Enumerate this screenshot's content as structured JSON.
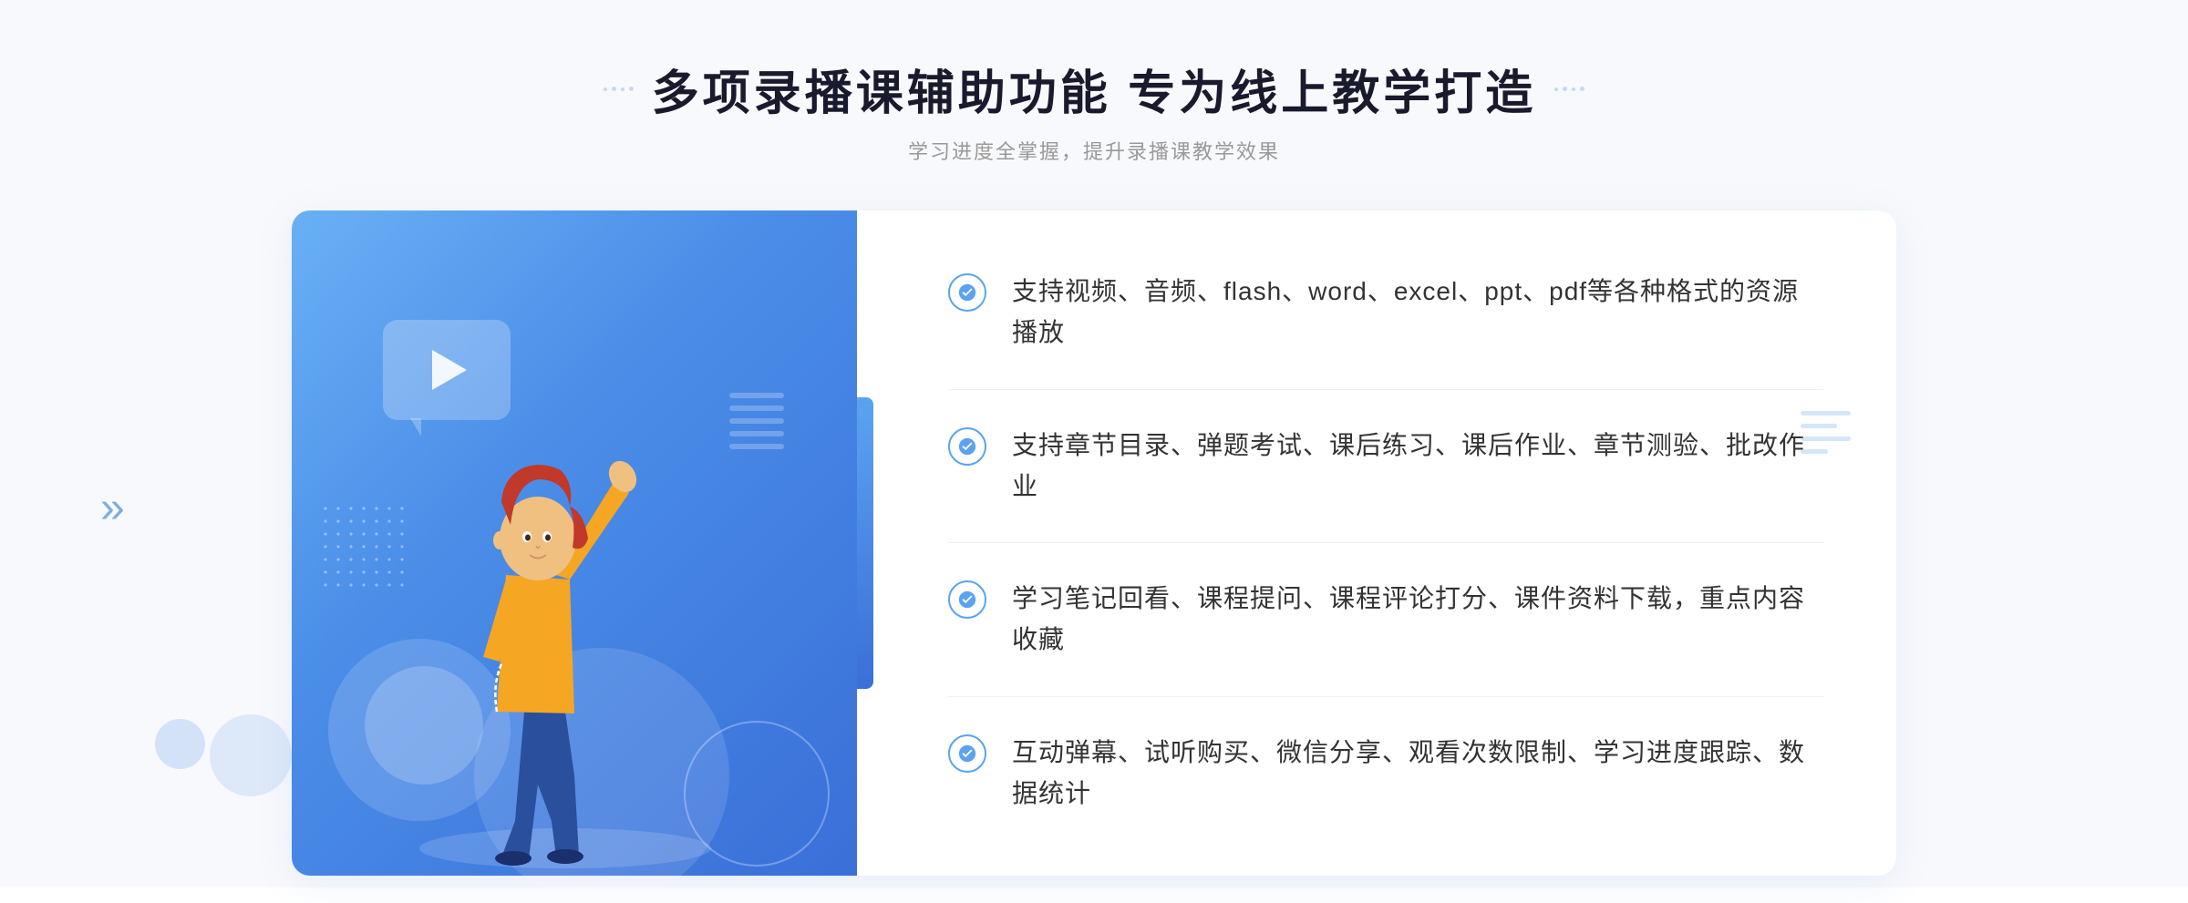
{
  "header": {
    "title": "多项录播课辅助功能 专为线上教学打造",
    "subtitle": "学习进度全掌握，提升录播课教学效果"
  },
  "decorations": {
    "chevron_left": "»",
    "chevron_right": "∷",
    "dot_deco_left": "∷",
    "dot_deco_right": "∷"
  },
  "features": [
    {
      "id": 1,
      "text": "支持视频、音频、flash、word、excel、ppt、pdf等各种格式的资源播放"
    },
    {
      "id": 2,
      "text": "支持章节目录、弹题考试、课后练习、课后作业、章节测验、批改作业"
    },
    {
      "id": 3,
      "text": "学习笔记回看、课程提问、课程评论打分、课件资料下载，重点内容收藏"
    },
    {
      "id": 4,
      "text": "互动弹幕、试听购买、微信分享、观看次数限制、学习进度跟踪、数据统计"
    }
  ],
  "colors": {
    "primary_blue": "#4a8de8",
    "light_blue": "#6ab0f5",
    "check_border": "#5ba3f0",
    "text_dark": "#1a1a2e",
    "text_body": "#333333",
    "text_light": "#999999",
    "bg": "#f8f9fc"
  }
}
